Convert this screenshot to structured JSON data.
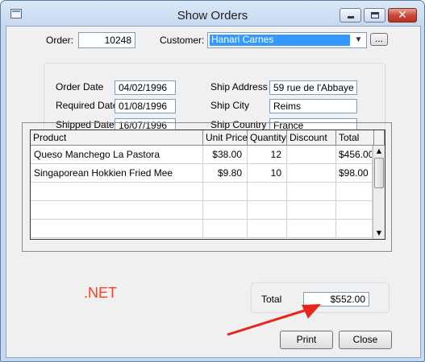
{
  "window": {
    "title": "Show Orders",
    "controls": {
      "minimize": "minimize",
      "maximize": "maximize",
      "close": "✕"
    }
  },
  "header": {
    "order_label": "Order:",
    "order_value": "10248",
    "customer_label": "Customer:",
    "customer_value": "Hanari Carnes",
    "browse_button": "..."
  },
  "details": {
    "order_date_label": "Order Date",
    "order_date": "04/02/1996",
    "required_date_label": "Required Date",
    "required_date": "01/08/1996",
    "shipped_date_label": "Shipped Date",
    "shipped_date": "16/07/1996",
    "ship_address_label": "Ship Address",
    "ship_address": "59 rue de l'Abbaye",
    "ship_city_label": "Ship City",
    "ship_city": "Reims",
    "ship_country_label": "Ship Country",
    "ship_country": "France"
  },
  "grid": {
    "columns": [
      "Product",
      "Unit Price",
      "Quantity",
      "Discount",
      "Total"
    ],
    "rows": [
      {
        "product": "Queso Manchego La Pastora",
        "unit_price": "$38.00",
        "quantity": "12",
        "discount": "",
        "total": "$456.00"
      },
      {
        "product": "Singaporean Hokkien Fried Mee",
        "unit_price": "$9.80",
        "quantity": "10",
        "discount": "",
        "total": "$98.00"
      }
    ]
  },
  "totals": {
    "label": "Total",
    "value": "$552.00"
  },
  "annotation": {
    "text": ".NET",
    "color": "#ff3f20"
  },
  "buttons": {
    "print": "Print",
    "close": "Close"
  }
}
